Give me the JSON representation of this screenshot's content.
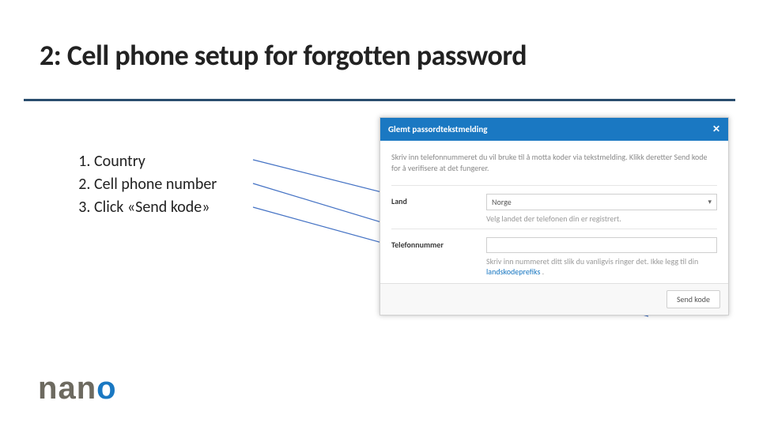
{
  "title": "2: Cell phone setup for forgotten password",
  "steps": {
    "items": [
      {
        "label": "Country"
      },
      {
        "label": "Cell phone number"
      },
      {
        "label": "Click «Send kode»"
      }
    ]
  },
  "dialog": {
    "header": "Glemt passordtekstmelding",
    "intro": "Skriv inn telefonnummeret du vil bruke til å motta koder via tekstmelding. Klikk deretter Send kode for å verifisere at det fungerer.",
    "field_land_label": "Land",
    "field_land_value": "Norge",
    "field_land_help": "Velg landet der telefonen din er registrert.",
    "field_phone_label": "Telefonnummer",
    "field_phone_help_pre": "Skriv inn nummeret ditt slik du vanligvis ringer det. Ikke legg til din ",
    "field_phone_help_link": "landskodeprefiks",
    "field_phone_help_post": " .",
    "send_button": "Send kode"
  },
  "logo": {
    "n1": "n",
    "a": "a",
    "n2": "n",
    "o": "o"
  }
}
